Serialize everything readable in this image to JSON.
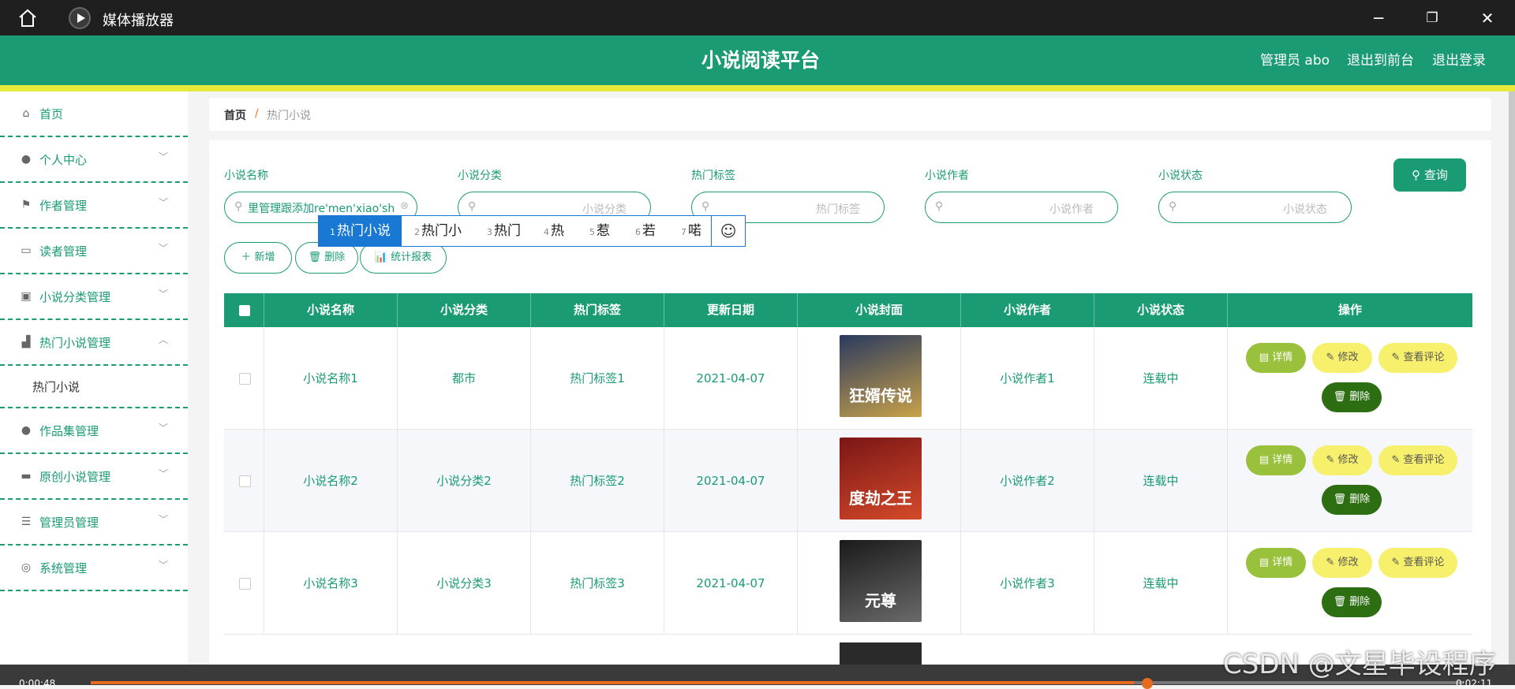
{
  "window": {
    "app_title": "媒体播放器",
    "buttons": {
      "minimize": "─",
      "maximize": "❐",
      "close": "✕"
    }
  },
  "header": {
    "site_title": "小说阅读平台",
    "links": [
      "管理员 abo",
      "退出到前台",
      "退出登录"
    ]
  },
  "sidebar": {
    "items": [
      {
        "label": "首页",
        "icon": "home-icon",
        "glyph": "⌂",
        "arrow": ""
      },
      {
        "label": "个人中心",
        "icon": "user-icon",
        "glyph": "●",
        "arrow": "﹀"
      },
      {
        "label": "作者管理",
        "icon": "flag-icon",
        "glyph": "⚑",
        "arrow": "﹀"
      },
      {
        "label": "读者管理",
        "icon": "chat-icon",
        "glyph": "▭",
        "arrow": "﹀"
      },
      {
        "label": "小说分类管理",
        "icon": "clipboard-icon",
        "glyph": "▣",
        "arrow": "﹀"
      },
      {
        "label": "热门小说管理",
        "icon": "chart-icon",
        "glyph": "▟",
        "arrow": "︿"
      },
      {
        "label": "作品集管理",
        "icon": "user-icon",
        "glyph": "●",
        "arrow": "﹀"
      },
      {
        "label": "原创小说管理",
        "icon": "monitor-icon",
        "glyph": "▬",
        "arrow": "﹀"
      },
      {
        "label": "管理员管理",
        "icon": "list-icon",
        "glyph": "☰",
        "arrow": "﹀"
      },
      {
        "label": "系统管理",
        "icon": "compass-icon",
        "glyph": "◎",
        "arrow": "﹀"
      }
    ],
    "submenu_label": "热门小说"
  },
  "breadcrumb": {
    "home": "首页",
    "separator": "/",
    "current": "热门小说"
  },
  "filters": [
    {
      "label": "小说名称",
      "value": "里管理跟添加re'men'xiao'sh",
      "placeholder": ""
    },
    {
      "label": "小说分类",
      "value": "",
      "placeholder": "小说分类"
    },
    {
      "label": "热门标签",
      "value": "",
      "placeholder": "热门标签"
    },
    {
      "label": "小说作者",
      "value": "",
      "placeholder": "小说作者"
    },
    {
      "label": "小说状态",
      "value": "",
      "placeholder": "小说状态"
    }
  ],
  "search_button": "查询",
  "ime": {
    "candidates": [
      {
        "num": "1",
        "text": "热门小说"
      },
      {
        "num": "2",
        "text": "热门小"
      },
      {
        "num": "3",
        "text": "热门"
      },
      {
        "num": "4",
        "text": "热"
      },
      {
        "num": "5",
        "text": "惹"
      },
      {
        "num": "6",
        "text": "若"
      },
      {
        "num": "7",
        "text": "喏"
      }
    ],
    "emoji": "☺"
  },
  "actions": {
    "add": "＋ 新增",
    "delete": "🗑 删除",
    "report": "📊 统计报表"
  },
  "table": {
    "headers": [
      "小说名称",
      "小说分类",
      "热门标签",
      "更新日期",
      "小说封面",
      "小说作者",
      "小说状态",
      "操作"
    ],
    "rows": [
      {
        "name": "小说名称1",
        "category": "都市",
        "tag": "热门标签1",
        "date": "2021-04-07",
        "cover_text": "狂婿传说",
        "cover_colors": [
          "#2a3a5e",
          "#c9a24a"
        ],
        "author": "小说作者1",
        "status": "连载中"
      },
      {
        "name": "小说名称2",
        "category": "小说分类2",
        "tag": "热门标签2",
        "date": "2021-04-07",
        "cover_text": "度劫之王",
        "cover_colors": [
          "#7a1616",
          "#d44a2a"
        ],
        "author": "小说作者2",
        "status": "连载中"
      },
      {
        "name": "小说名称3",
        "category": "小说分类3",
        "tag": "热门标签3",
        "date": "2021-04-07",
        "cover_text": "元尊",
        "cover_colors": [
          "#1a1a1a",
          "#6a6a6a"
        ],
        "author": "小说作者3",
        "status": "连载中"
      }
    ],
    "ops": {
      "detail": "▤ 详情",
      "edit": "✎ 修改",
      "review": "✎ 查看评论",
      "delete": "🗑 删除"
    }
  },
  "video": {
    "current_time": "0:00:48",
    "total_time": "0:02:11",
    "progress": 0.76
  },
  "watermark": "CSDN @文星毕设程序"
}
